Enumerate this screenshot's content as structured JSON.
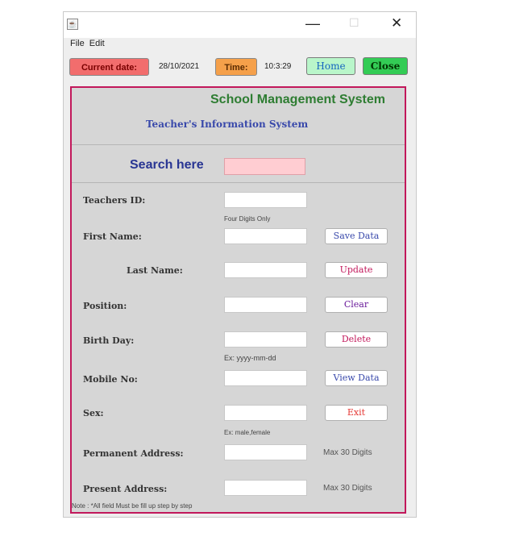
{
  "window": {
    "controls": {
      "minimize": "—",
      "maximize": "☐",
      "close": "✕"
    }
  },
  "menu": {
    "file": "File",
    "edit": "Edit"
  },
  "topbar": {
    "current_date_label": "Current date:",
    "current_date_value": "28/10/2021",
    "time_label": "Time:",
    "time_value": "10:3:29",
    "home_label": "Home",
    "close_label": "Close"
  },
  "header": {
    "title": "School Management System",
    "subtitle": "Teacher's Information System"
  },
  "search": {
    "label": "Search here",
    "value": ""
  },
  "form": {
    "teacher_id": {
      "label": "Teachers ID:",
      "value": "",
      "hint": "Four Digits Only"
    },
    "first_name": {
      "label": "First Name:",
      "value": ""
    },
    "last_name": {
      "label": "Last Name:",
      "value": ""
    },
    "position": {
      "label": "Position:",
      "value": ""
    },
    "birth_day": {
      "label": "Birth Day:",
      "value": "",
      "hint": "Ex: yyyy-mm-dd"
    },
    "mobile_no": {
      "label": "Mobile No:",
      "value": ""
    },
    "sex": {
      "label": "Sex:",
      "value": "",
      "hint": "Ex: male,female"
    },
    "permanent_address": {
      "label": "Permanent Address:",
      "value": "",
      "max_hint": "Max 30 Digits"
    },
    "present_address": {
      "label": "Present Address:",
      "value": "",
      "max_hint": "Max 30 Digits"
    }
  },
  "actions": {
    "save_label": "Save Data",
    "update_label": "Update",
    "clear_label": "Clear",
    "delete_label": "Delete",
    "view_label": "View Data",
    "exit_label": "Exit"
  },
  "note": "Note : *All field Must be fill up step by step",
  "colors": {
    "panel_border": "#c2185b",
    "title_green": "#2e7d32",
    "subtitle_blue": "#3949ab",
    "search_field": "#ffcdd2",
    "current_date_tag": "#f26d6d",
    "time_tag": "#f5a04a",
    "home_btn": "#b9f6ca",
    "close_btn": "#33cc55"
  },
  "icons": {
    "app": "java-app-icon",
    "cursor": "mouse-pointer-icon"
  }
}
